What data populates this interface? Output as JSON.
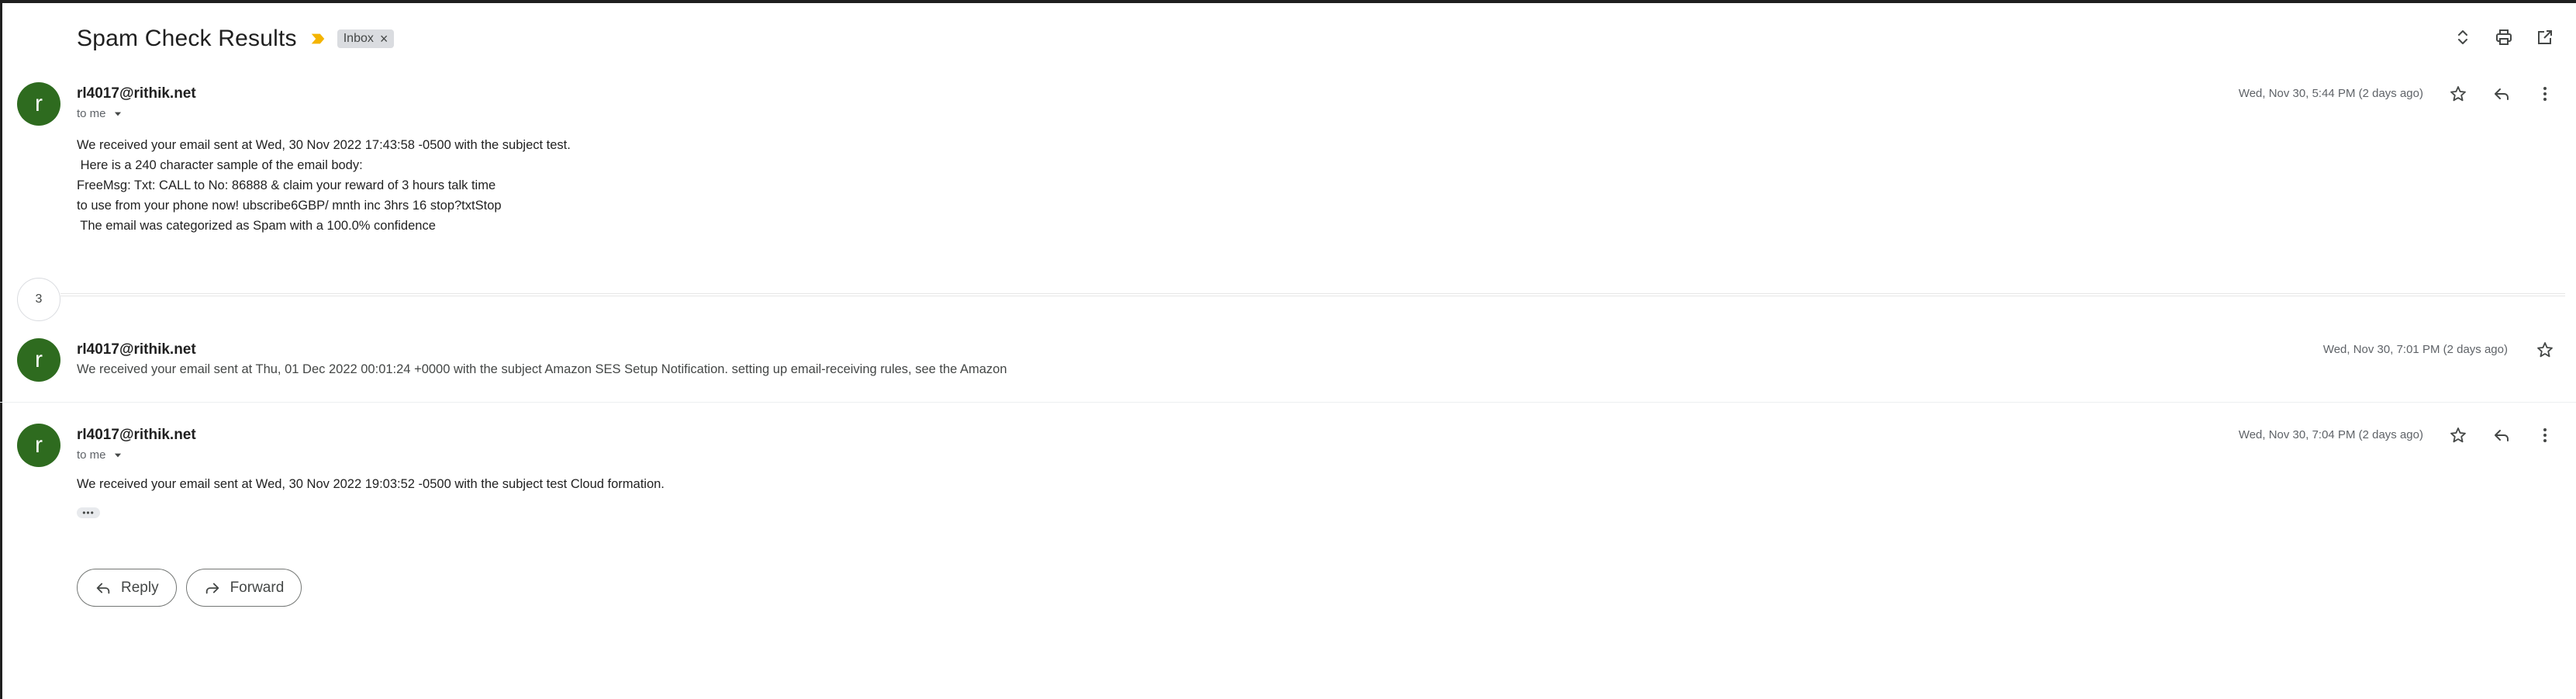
{
  "thread": {
    "subject": "Spam Check Results",
    "label": "Inbox",
    "label_remove": "×",
    "collapsed_count": "3"
  },
  "icons": {
    "important": "important-marker-icon",
    "expand": "expand-all-icon",
    "print": "print-icon",
    "popout": "open-in-new-window-icon",
    "star": "star-icon",
    "reply": "reply-icon",
    "more": "more-vertical-icon",
    "dropdown": "caret-down-icon",
    "forward": "forward-icon"
  },
  "colors": {
    "avatar": "#2e6b1f",
    "important": "#f4b400"
  },
  "messages": [
    {
      "avatar_letter": "r",
      "sender": "rl4017@rithik.net",
      "to": "to me",
      "date": "Wed, Nov 30, 5:44 PM (2 days ago)",
      "body_lines": [
        "We received your email sent at Wed, 30 Nov 2022 17:43:58 -0500 with the subject test.",
        " Here is a 240 character sample of the email body:",
        "FreeMsg: Txt: CALL to No: 86888 & claim your reward of 3 hours talk time",
        "to use from your phone now! ubscribe6GBP/ mnth inc 3hrs 16 stop?txtStop",
        " The email was categorized as Spam with a 100.0% confidence"
      ]
    },
    {
      "avatar_letter": "r",
      "sender": "rl4017@rithik.net",
      "date": "Wed, Nov 30, 7:01 PM (2 days ago)",
      "snippet": "We received your email sent at Thu, 01 Dec 2022 00:01:24 +0000 with the subject Amazon SES Setup Notification. setting up email-receiving rules, see the Amazon"
    },
    {
      "avatar_letter": "r",
      "sender": "rl4017@rithik.net",
      "to": "to me",
      "date": "Wed, Nov 30, 7:04 PM (2 days ago)",
      "body_lines": [
        "We received your email sent at Wed, 30 Nov 2022 19:03:52 -0500 with the subject test Cloud formation."
      ],
      "more_content": "•••"
    }
  ],
  "reply_bar": {
    "reply_label": "Reply",
    "forward_label": "Forward"
  }
}
